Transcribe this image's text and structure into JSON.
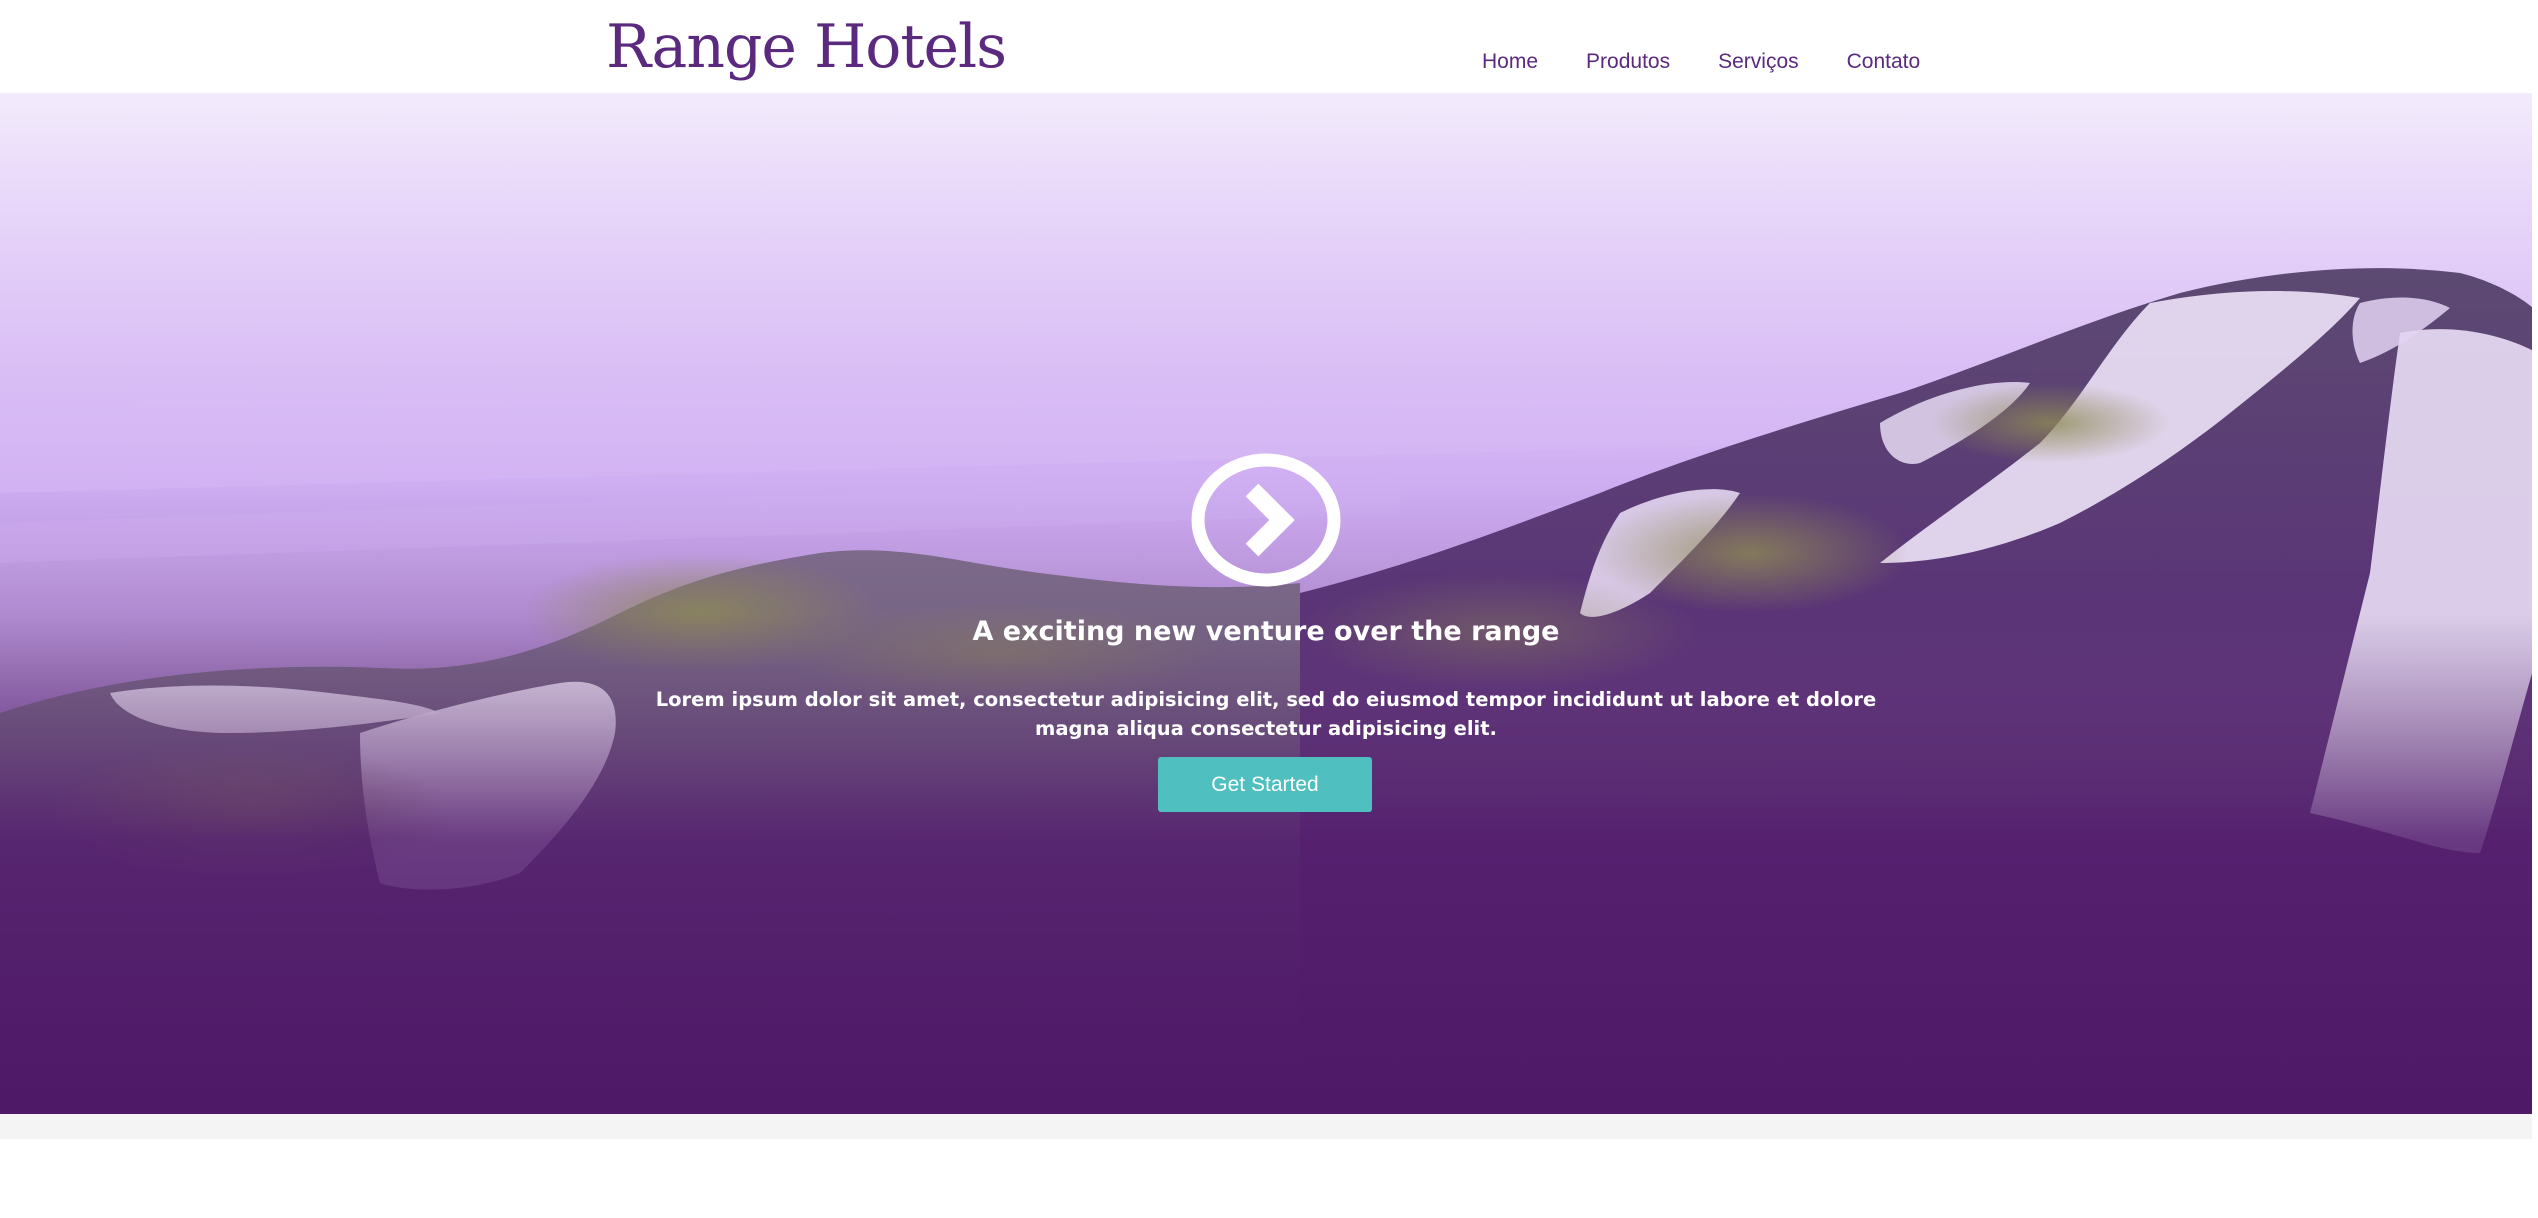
{
  "header": {
    "logo_text": "Range Hotels",
    "nav": [
      "Home",
      "Produtos",
      "Serviços",
      "Contato"
    ]
  },
  "hero": {
    "icon": "chevron-circle-right-icon",
    "title": "A exciting new venture over the range",
    "text": "Lorem ipsum dolor sit amet, consectetur adipisicing elit, sed do eiusmod tempor incididunt ut labore et dolore magna aliqua consectetur adipisicing elit.",
    "button_label": "Get Started"
  },
  "colors": {
    "brand_purple": "#5b2a7f",
    "button_teal": "#4fbfc0",
    "hero_deep": "#4e1a67",
    "hero_light": "#f2e8fb"
  }
}
